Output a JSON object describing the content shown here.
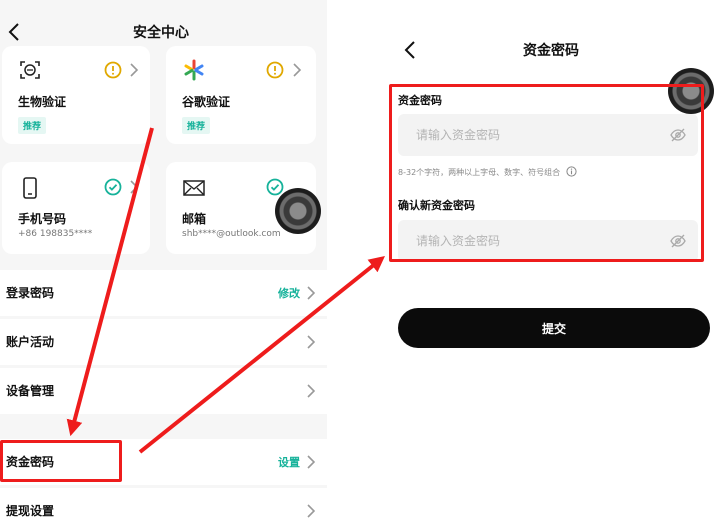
{
  "left": {
    "title": "安全中心",
    "cards": [
      {
        "title": "生物验证",
        "badge": "推荐",
        "icon": "face-scan-icon",
        "status": "warning-icon"
      },
      {
        "title": "谷歌验证",
        "badge": "推荐",
        "icon": "google-authenticator-icon",
        "status": "warning-icon"
      },
      {
        "title": "手机号码",
        "sub": "+86 198835****",
        "icon": "phone-icon",
        "status": "check-icon"
      },
      {
        "title": "邮箱",
        "sub": "shb****@outlook.com",
        "icon": "envelope-icon",
        "status": "check-icon"
      }
    ],
    "rows": [
      {
        "label": "登录密码",
        "action": "修改"
      },
      {
        "label": "账户活动",
        "action": ""
      },
      {
        "label": "设备管理",
        "action": ""
      },
      {
        "label": "资金密码",
        "action": "设置"
      },
      {
        "label": "提现设置",
        "action": ""
      }
    ]
  },
  "right": {
    "title": "资金密码",
    "fund_password_label": "资金密码",
    "fund_password_placeholder": "请输入资金密码",
    "hint": "8-32个字符，两种以上字母、数字、符号组合",
    "confirm_label": "确认新资金密码",
    "confirm_placeholder": "请输入资金密码",
    "submit_label": "提交"
  },
  "colors": {
    "accent": "#16b29a",
    "warning": "#e0a800",
    "highlight": "#ee1c1c",
    "submit": "#0b0b0b"
  }
}
